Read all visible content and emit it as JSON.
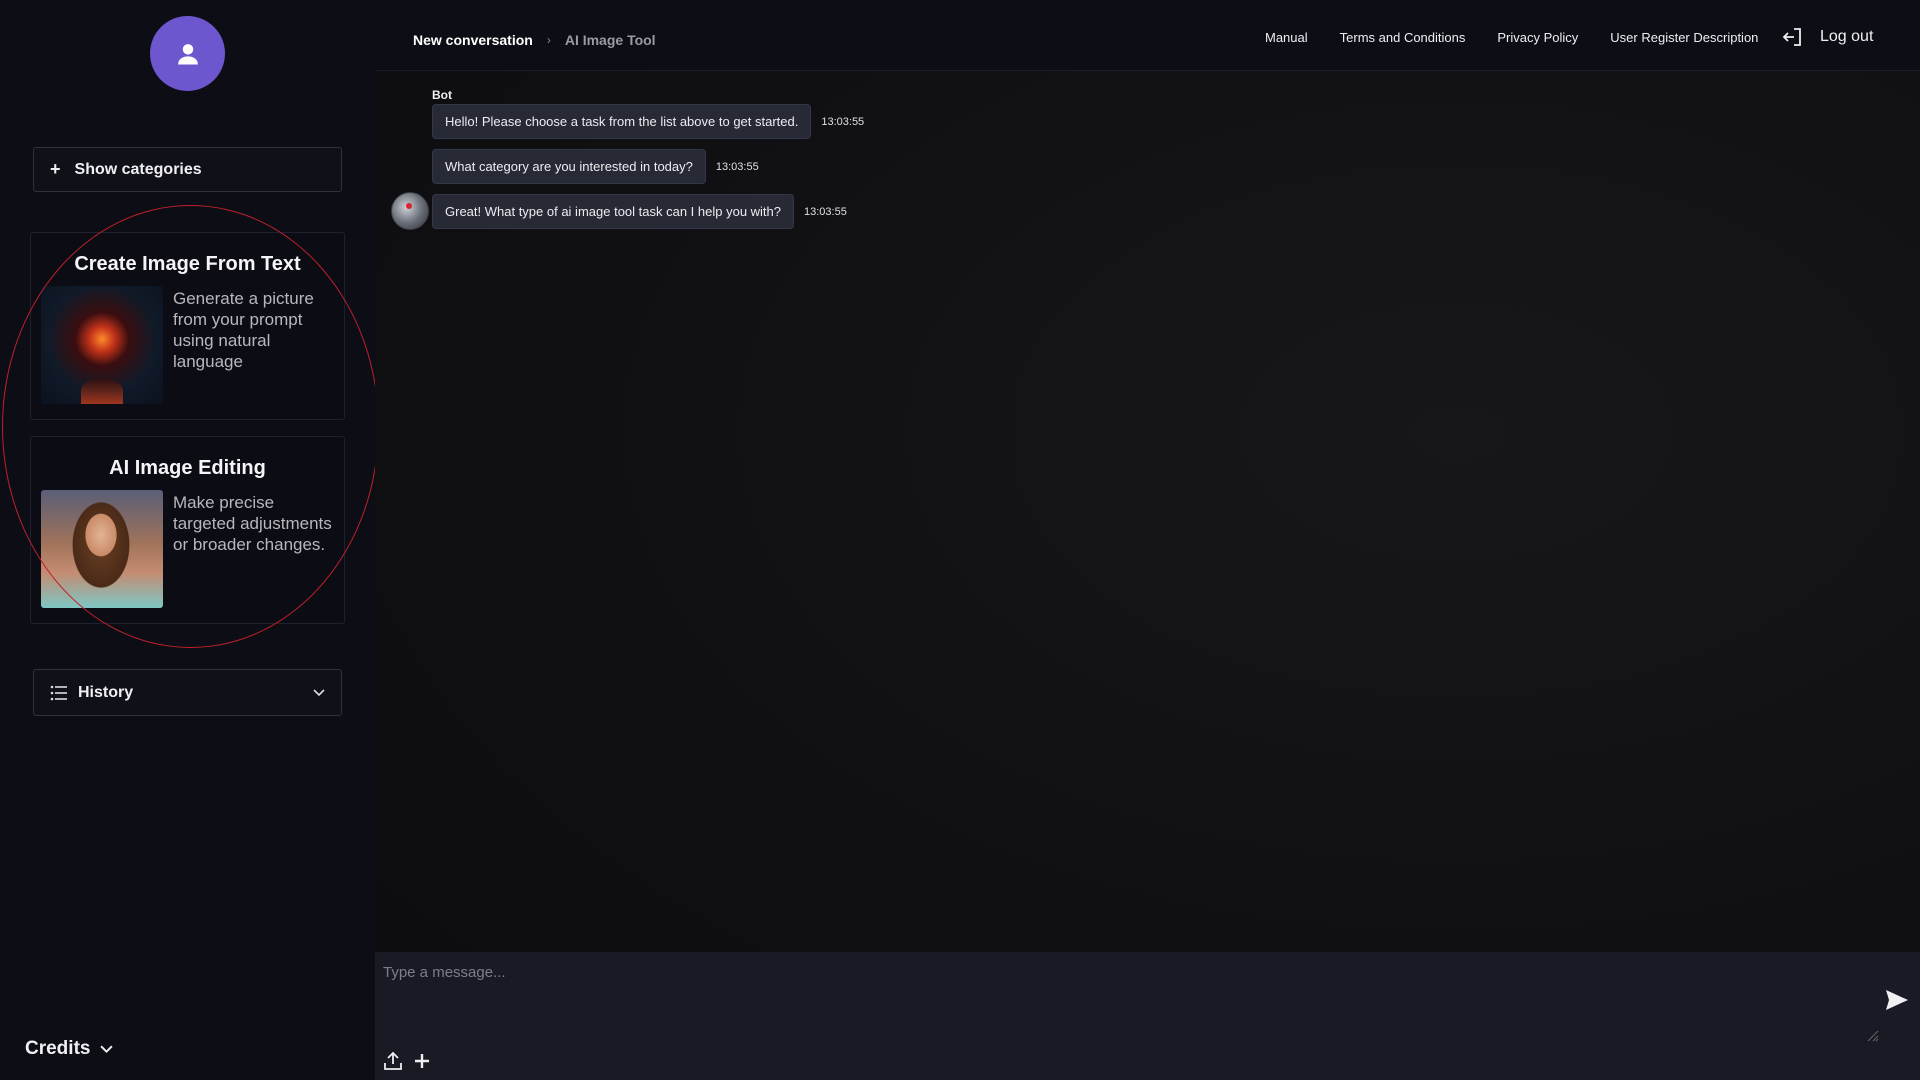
{
  "sidebar": {
    "show_categories_label": "Show categories",
    "cards": [
      {
        "title": "Create Image From Text",
        "description": "Generate a picture from your prompt using natural language"
      },
      {
        "title": "AI Image Editing",
        "description": "Make precise targeted adjustments or broader changes."
      }
    ],
    "history_label": "History",
    "credits_label": "Credits"
  },
  "header": {
    "breadcrumb": [
      "New conversation",
      "AI Image Tool"
    ],
    "nav": [
      "Manual",
      "Terms and Conditions",
      "Privacy Policy",
      "User Register Description"
    ],
    "logout_label": "Log out"
  },
  "chat": {
    "sender": "Bot",
    "messages": [
      {
        "text": "Hello! Please choose a task from the list above to get started.",
        "time": "13:03:55"
      },
      {
        "text": "What category are you interested in today?",
        "time": "13:03:55"
      },
      {
        "text": "Great! What type of ai image tool task can I help you with?",
        "time": "13:03:55"
      }
    ]
  },
  "composer": {
    "placeholder": "Type a message..."
  },
  "icons": {
    "avatar": "user-icon",
    "send": "send-icon",
    "upload": "upload-icon",
    "add": "plus-icon",
    "history": "list-icon",
    "logout": "logout-icon"
  },
  "colors": {
    "accent": "#6e56cf",
    "highlight": "#c0202a",
    "background": "#0e0e11"
  }
}
